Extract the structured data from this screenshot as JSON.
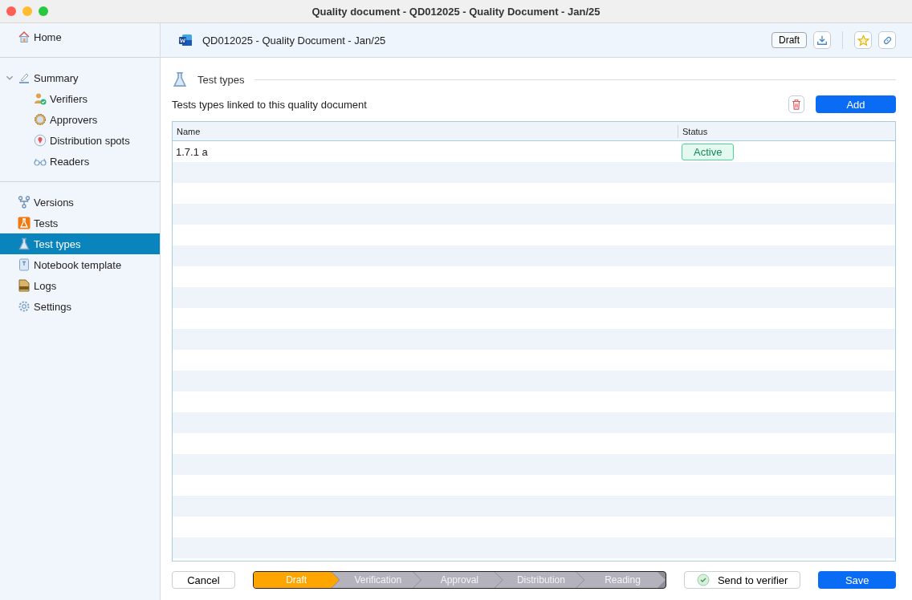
{
  "window": {
    "title": "Quality document - QD012025 - Quality Document - Jan/25"
  },
  "sidebar": {
    "groups": [
      {
        "items": [
          {
            "label": "Home",
            "selected": false
          }
        ]
      },
      {
        "items": [
          {
            "label": "Summary",
            "selected": false,
            "expanded": true,
            "children": [
              {
                "label": "Verifiers",
                "selected": false
              },
              {
                "label": "Approvers",
                "selected": false
              },
              {
                "label": "Distribution spots",
                "selected": false
              },
              {
                "label": "Readers",
                "selected": false
              }
            ]
          }
        ]
      },
      {
        "items": [
          {
            "label": "Versions",
            "selected": false
          },
          {
            "label": "Tests",
            "selected": false
          },
          {
            "label": "Test types",
            "selected": true
          },
          {
            "label": "Notebook template",
            "selected": false
          },
          {
            "label": "Logs",
            "selected": false
          },
          {
            "label": "Settings",
            "selected": false
          }
        ]
      }
    ]
  },
  "header": {
    "title": "QD012025 - Quality Document - Jan/25",
    "status": "Draft"
  },
  "section": {
    "title": "Test types",
    "description": "Tests types linked to this quality document",
    "add_button": "Add"
  },
  "table": {
    "columns": [
      "Name",
      "Status"
    ],
    "rows": [
      {
        "name": "1.7.1 a",
        "status": "Active"
      }
    ]
  },
  "footer": {
    "cancel": "Cancel",
    "steps": [
      {
        "label": "Draft",
        "selected": true
      },
      {
        "label": "Verification",
        "selected": false
      },
      {
        "label": "Approval",
        "selected": false
      },
      {
        "label": "Distribution",
        "selected": false
      },
      {
        "label": "Reading",
        "selected": false
      }
    ],
    "send": "Send to verifier",
    "save": "Save"
  }
}
